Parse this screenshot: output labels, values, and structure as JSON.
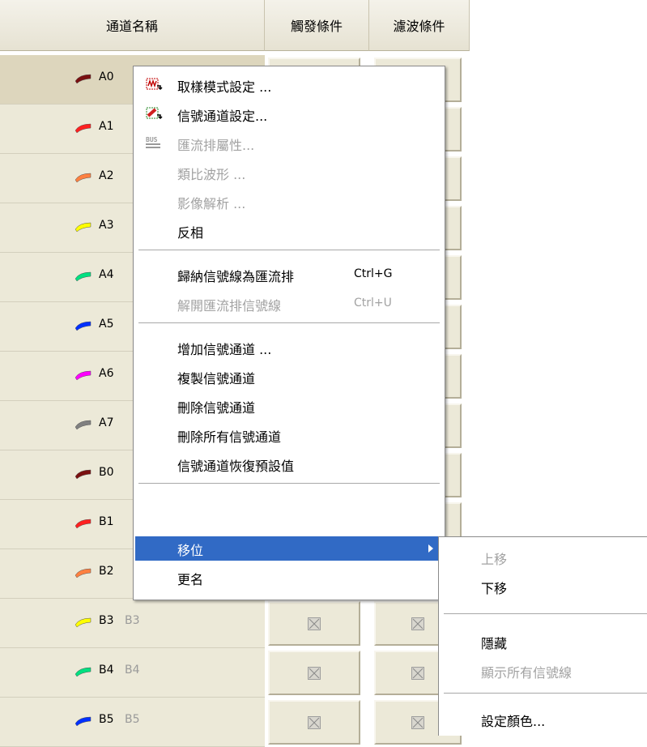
{
  "grid": {
    "headers": {
      "name": "通道名稱",
      "trigger": "觸發條件",
      "filter": "濾波條件"
    },
    "rows": [
      {
        "label": "A0",
        "alias": "",
        "color": "#7a1010"
      },
      {
        "label": "A1",
        "alias": "",
        "color": "#ff2020"
      },
      {
        "label": "A2",
        "alias": "",
        "color": "#ff8040"
      },
      {
        "label": "A3",
        "alias": "",
        "color": "#ffff00"
      },
      {
        "label": "A4",
        "alias": "",
        "color": "#00e080"
      },
      {
        "label": "A5",
        "alias": "",
        "color": "#0030ff"
      },
      {
        "label": "A6",
        "alias": "",
        "color": "#ff00ff"
      },
      {
        "label": "A7",
        "alias": "",
        "color": "#808080"
      },
      {
        "label": "B0",
        "alias": "",
        "color": "#7a1010"
      },
      {
        "label": "B1",
        "alias": "",
        "color": "#ff2020"
      },
      {
        "label": "B2",
        "alias": "",
        "color": "#ff8040"
      },
      {
        "label": "B3",
        "alias": "B3",
        "color": "#ffff00"
      },
      {
        "label": "B4",
        "alias": "B4",
        "color": "#00e080"
      },
      {
        "label": "B5",
        "alias": "B5",
        "color": "#0030ff"
      }
    ]
  },
  "context_menu": {
    "items": [
      {
        "label": "取樣模式設定 ...",
        "icon": "sampling-mode-icon",
        "enabled": true
      },
      {
        "label": "信號通道設定...",
        "icon": "channel-settings-icon",
        "enabled": true
      },
      {
        "label": "匯流排屬性...",
        "icon": "bus-icon",
        "enabled": false
      },
      {
        "label": "類比波形 ...",
        "enabled": false
      },
      {
        "label": "影像解析 ...",
        "enabled": false
      },
      {
        "label": "反相",
        "enabled": true
      },
      {
        "label": "歸納信號線為匯流排",
        "shortcut": "Ctrl+G",
        "enabled": true
      },
      {
        "label": "解開匯流排信號線",
        "shortcut": "Ctrl+U",
        "enabled": false
      },
      {
        "label": "增加信號通道 ...",
        "enabled": true
      },
      {
        "label": "複製信號通道",
        "enabled": true
      },
      {
        "label": "刪除信號通道",
        "enabled": true
      },
      {
        "label": "刪除所有信號通道",
        "enabled": true
      },
      {
        "label": "信號通道恢復預設值",
        "enabled": true
      },
      {
        "label": "移位",
        "enabled": true,
        "highlighted": true
      },
      {
        "label": "更名",
        "enabled": true
      }
    ]
  },
  "submenu": {
    "items": [
      {
        "label": "上移",
        "enabled": false
      },
      {
        "label": "下移",
        "enabled": true
      },
      {
        "label": "隱藏",
        "enabled": true
      },
      {
        "label": "顯示所有信號線",
        "enabled": false
      },
      {
        "label": "設定顏色...",
        "enabled": true
      }
    ]
  },
  "colors": {
    "menu_highlight": "#316ac5",
    "grid_bg": "#ece9d8"
  }
}
